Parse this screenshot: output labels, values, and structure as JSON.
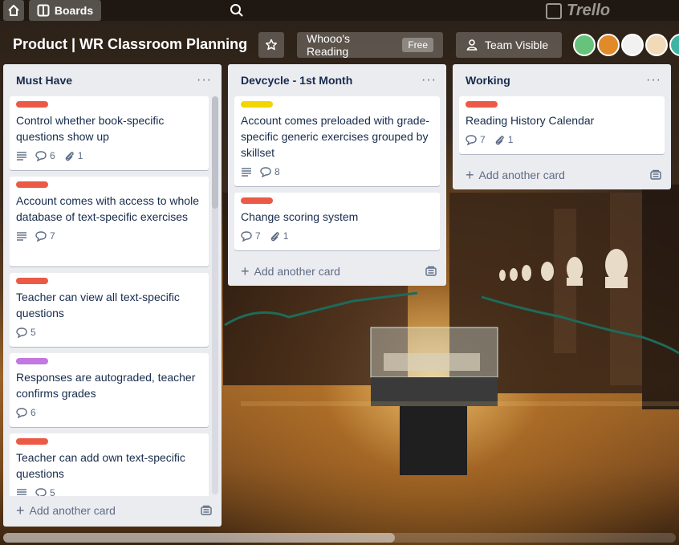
{
  "topbar": {
    "boards_label": "Boards"
  },
  "logo": {
    "text": "Trello"
  },
  "board": {
    "title": "Product | WR Classroom Planning",
    "team": "Whooo's Reading",
    "plan_badge": "Free",
    "visibility": "Team Visible"
  },
  "colors": {
    "red": "#eb5a46",
    "yellow": "#f2d600",
    "purple": "#c377e0"
  },
  "avatars": [
    "#67c27b",
    "#e08a2a",
    "#ffffff",
    "#f2d9b8",
    "#3fb4a4"
  ],
  "lists": [
    {
      "title": "Must Have",
      "add_label": "Add another card",
      "cards": [
        {
          "label": "red",
          "title": "Control whether book-specific questions show up",
          "desc": true,
          "comments": "6",
          "attachments": "1"
        },
        {
          "label": "red",
          "title": "Account comes with access to whole database of text-specific exercises",
          "desc": true,
          "comments": "7"
        },
        {
          "label": "red",
          "title": "Teacher can view all text-specific questions",
          "comments": "5"
        },
        {
          "label": "purple",
          "title": "Responses are autograded, teacher confirms grades",
          "comments": "6"
        },
        {
          "label": "red",
          "title": "Teacher can add own text-specific questions",
          "desc": true,
          "comments": "5"
        }
      ]
    },
    {
      "title": "Devcycle - 1st Month",
      "add_label": "Add another card",
      "cards": [
        {
          "label": "yellow",
          "title": "Account comes preloaded with grade-specific generic exercises grouped by skillset",
          "desc": true,
          "comments": "8"
        },
        {
          "label": "red",
          "title": "Change scoring system",
          "comments": "7",
          "attachments": "1"
        }
      ]
    },
    {
      "title": "Working",
      "add_label": "Add another card",
      "cards": [
        {
          "label": "red",
          "title": "Reading History Calendar",
          "comments": "7",
          "attachments": "1"
        }
      ]
    }
  ]
}
